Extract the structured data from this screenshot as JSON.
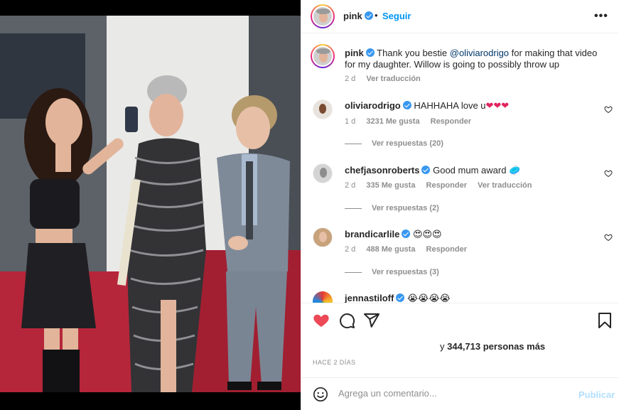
{
  "post": {
    "username": "pink",
    "follow_label": "Seguir",
    "separator": "•",
    "more_label": "•••"
  },
  "caption": {
    "username": "pink",
    "text_before": "Thank you bestie ",
    "mention": "@oliviarodrigo",
    "text_after": " for making that video for my daughter. Willow is going to possibly throw up",
    "time": "2 d",
    "translate_label": "Ver traducción"
  },
  "comments": [
    {
      "username": "oliviarodrigo",
      "text": "HAHHAHA love u",
      "emoji": "❤❤❤",
      "time": "1 d",
      "likes": "3231 Me gusta",
      "reply_label": "Responder",
      "translate_label": "",
      "replies_label": "Ver respuestas (20)"
    },
    {
      "username": "chefjasonroberts",
      "text": "Good mum award",
      "emoji": "🥏",
      "time": "2 d",
      "likes": "335 Me gusta",
      "reply_label": "Responder",
      "translate_label": "Ver traducción",
      "replies_label": "Ver respuestas (2)"
    },
    {
      "username": "brandicarlile",
      "text": "",
      "emoji": "😍😍😍",
      "time": "2 d",
      "likes": "488 Me gusta",
      "reply_label": "Responder",
      "translate_label": "",
      "replies_label": "Ver respuestas (3)"
    },
    {
      "username": "jennastiloff",
      "text": "",
      "emoji": "😭😭😭😭",
      "time": "",
      "likes": "",
      "reply_label": "",
      "translate_label": "",
      "replies_label": ""
    }
  ],
  "actions": {
    "likes_prefix": "y",
    "likes_text": "344,713 personas más",
    "posted_ago": "HACE 2 DÍAS"
  },
  "add_comment": {
    "placeholder": "Agrega un comentario...",
    "publish_label": "Publicar"
  },
  "colors": {
    "accent": "#0095f6",
    "like_red": "#ed4956",
    "publish_disabled": "#b2dffc",
    "verified": "#3897f0"
  },
  "icons": {
    "like": "heart-icon",
    "comment": "comment-icon",
    "share": "share-icon",
    "save": "bookmark-icon",
    "emoji": "emoji-icon",
    "more": "more-icon",
    "verified": "verified-badge-icon"
  }
}
